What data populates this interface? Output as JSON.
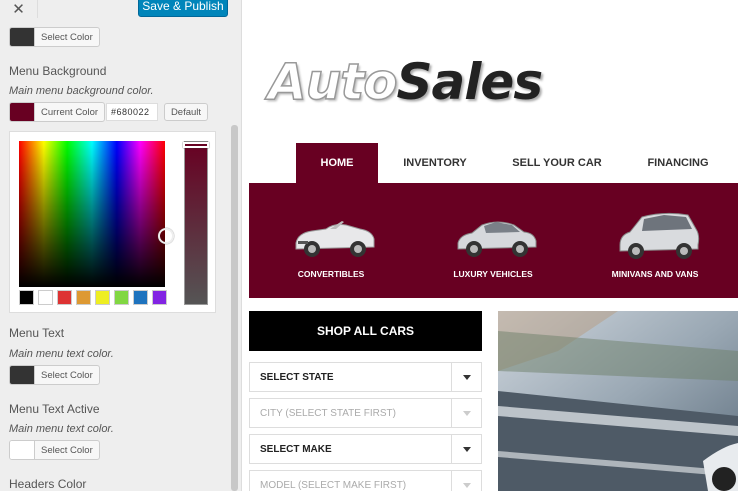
{
  "panel": {
    "close_icon": "close-icon",
    "publish_label": "Save & Publish",
    "top_color_btn": {
      "label": "Select Color",
      "swatch": "#333333"
    },
    "menu_background": {
      "title": "Menu Background",
      "desc": "Main menu background color.",
      "current_label": "Current Color",
      "swatch": "#680022",
      "hex_value": "#680022",
      "default_label": "Default"
    },
    "palette": [
      "#000000",
      "#ffffff",
      "#dd3333",
      "#dd9933",
      "#eeee22",
      "#81d742",
      "#1e73be",
      "#8224e3"
    ],
    "menu_text": {
      "title": "Menu Text",
      "desc": "Main menu text color.",
      "btn_label": "Select Color",
      "swatch": "#333333"
    },
    "menu_text_active": {
      "title": "Menu Text Active",
      "desc": "Main menu text color.",
      "btn_label": "Select Color",
      "swatch": "#ffffff"
    },
    "headers_color": {
      "title": "Headers Color"
    }
  },
  "site": {
    "logo_auto": "Auto",
    "logo_sales": "Sales",
    "nav": [
      {
        "label": "HOME",
        "active": true
      },
      {
        "label": "INVENTORY",
        "active": false
      },
      {
        "label": "SELL YOUR CAR",
        "active": false
      },
      {
        "label": "FINANCING",
        "active": false
      }
    ],
    "categories": [
      {
        "label": "CONVERTIBLES",
        "icon": "convertible-car-icon"
      },
      {
        "label": "LUXURY VEHICLES",
        "icon": "sedan-car-icon"
      },
      {
        "label": "MINIVANS AND VANS",
        "icon": "minivan-car-icon"
      }
    ],
    "shop_all": "SHOP ALL CARS",
    "selects": [
      {
        "label": "SELECT STATE",
        "disabled": false
      },
      {
        "label": "CITY (SELECT STATE FIRST)",
        "disabled": true
      },
      {
        "label": "SELECT MAKE",
        "disabled": false
      },
      {
        "label": "MODEL (SELECT MAKE FIRST)",
        "disabled": true
      }
    ],
    "accent": "#680022"
  }
}
